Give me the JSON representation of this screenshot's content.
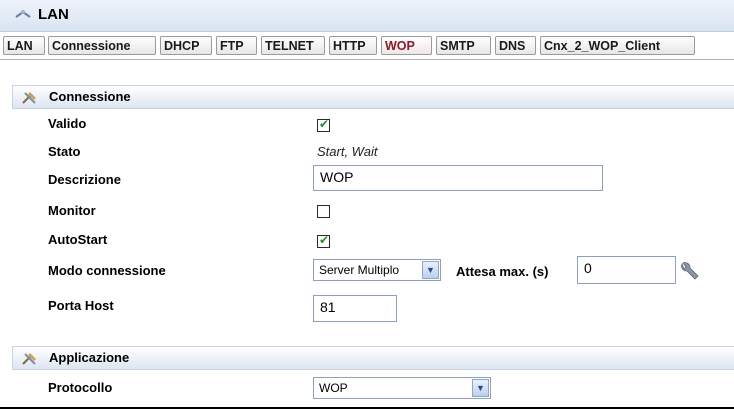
{
  "window": {
    "title": "LAN"
  },
  "tabs": [
    {
      "label": "LAN"
    },
    {
      "label": "Connessione"
    },
    {
      "label": "DHCP"
    },
    {
      "label": "FTP"
    },
    {
      "label": "TELNET"
    },
    {
      "label": "HTTP"
    },
    {
      "label": "WOP",
      "active": true
    },
    {
      "label": "SMTP"
    },
    {
      "label": "DNS"
    },
    {
      "label": "Cnx_2_WOP_Client"
    }
  ],
  "connessione": {
    "title": "Connessione",
    "valido": {
      "label": "Valido",
      "checked": true
    },
    "stato": {
      "label": "Stato",
      "value": "Start, Wait"
    },
    "descrizione": {
      "label": "Descrizione",
      "value": "WOP"
    },
    "monitor": {
      "label": "Monitor",
      "checked": false
    },
    "autostart": {
      "label": "AutoStart",
      "checked": true
    },
    "modo": {
      "label": "Modo connessione",
      "selected": "Server Multiplo"
    },
    "attesa": {
      "label": "Attesa max. (s)",
      "value": "0"
    },
    "porta": {
      "label": "Porta Host",
      "value": "81"
    }
  },
  "applicazione": {
    "title": "Applicazione",
    "protocollo": {
      "label": "Protocollo",
      "selected": "WOP"
    }
  },
  "check_mark": "✔",
  "dropdown_arrow": "▼",
  "icons": {
    "window": "network-icon",
    "section": "tools-icon",
    "config": "wrench-icon"
  }
}
